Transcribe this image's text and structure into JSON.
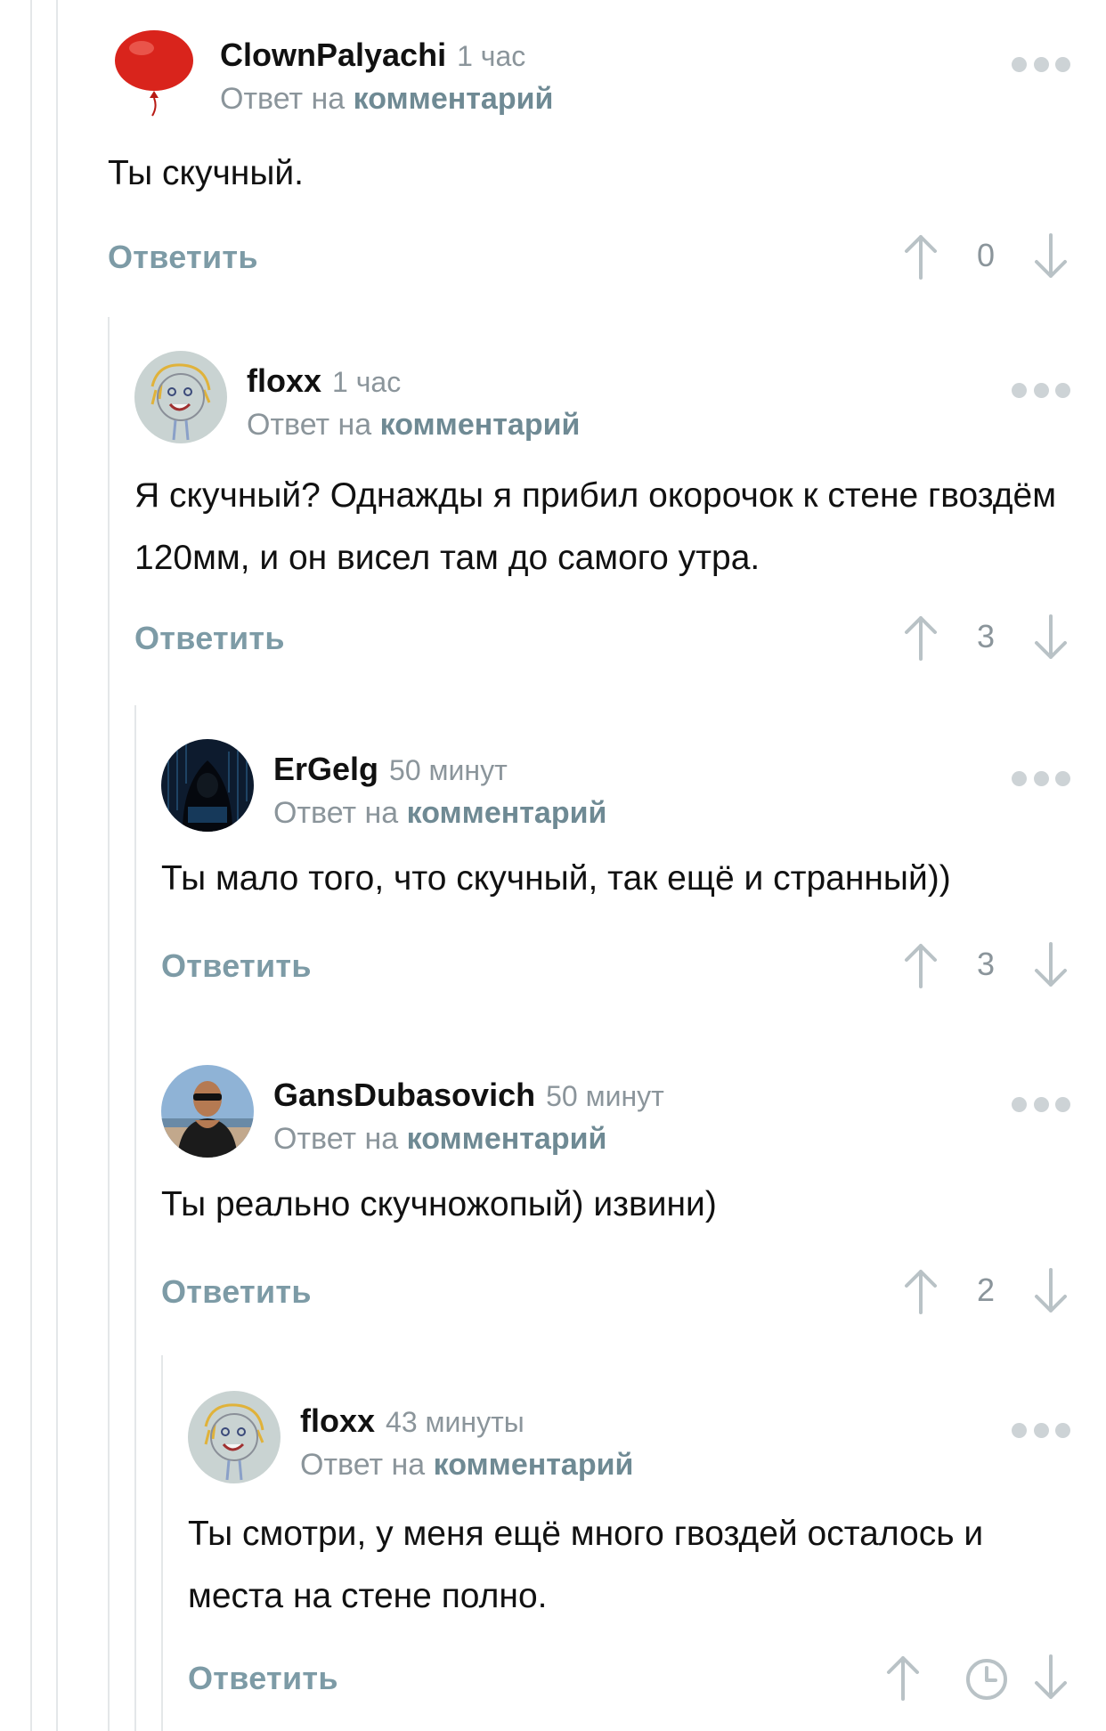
{
  "reply_to_prefix": "Ответ на",
  "reply_to_link": "комментарий",
  "reply_label": "Ответить",
  "comments": [
    {
      "author": "ClownPalyachi",
      "time": "1 час",
      "avatar": "red-balloon",
      "text": "Ты скучный.",
      "score": "0"
    },
    {
      "author": "floxx",
      "time": "1 час",
      "avatar": "child-drawing",
      "text": "Я скучный? Однажды я прибил окорочок к стене гвоздём 120мм, и он висел там до самого утра.",
      "score": "3"
    },
    {
      "author": "ErGelg",
      "time": "50 минут",
      "avatar": "hacker-hoodie",
      "text": "Ты мало того, что скучный, так ещё и странный))",
      "score": "3"
    },
    {
      "author": "GansDubasovich",
      "time": "50 минут",
      "avatar": "man-sunglasses-photo",
      "text": "Ты реально скучножопый) извини)",
      "score": "2"
    },
    {
      "author": "floxx",
      "time": "43 минуты",
      "avatar": "child-drawing",
      "text": "Ты смотри, у меня ещё много гвоздей осталось и места на стене полно.",
      "score": null
    }
  ]
}
